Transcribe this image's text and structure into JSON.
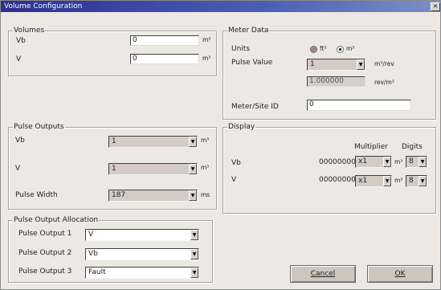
{
  "window": {
    "title": "Volume Configuration"
  },
  "volumes": {
    "legend": "Volumes",
    "vb_label": "Vb",
    "vb_value": "0",
    "vb_unit": "m³",
    "v_label": "V",
    "v_value": "0",
    "v_unit": "m³"
  },
  "pulse_outputs": {
    "legend": "Pulse Outputs",
    "vb_label": "Vb",
    "vb_value": "1",
    "vb_unit": "m³",
    "v_label": "V",
    "v_value": "1",
    "v_unit": "m³",
    "width_label": "Pulse Width",
    "width_value": "187",
    "width_unit": "ms"
  },
  "allocation": {
    "legend": "Pulse Output Allocation",
    "rows": [
      {
        "label": "Pulse Output 1",
        "value": "V"
      },
      {
        "label": "Pulse Output 2",
        "value": "Vb"
      },
      {
        "label": "Pulse Output 3",
        "value": "Fault"
      }
    ]
  },
  "meter_data": {
    "legend": "Meter Data",
    "units_label": "Units",
    "unit_ft3": "ft³",
    "unit_m3": "m³",
    "units_selected": "m³",
    "pulse_value_label": "Pulse Value",
    "pulse_value": "1",
    "pulse_value_unit": "m³/rev",
    "rev_value": "1.000000",
    "rev_unit": "rev/m³",
    "site_id_label": "Meter/Site ID",
    "site_id_value": "0"
  },
  "display": {
    "legend": "Display",
    "multiplier_header": "Multiplier",
    "digits_header": "Digits",
    "rows": [
      {
        "label": "Vb",
        "value": "00000000",
        "multiplier": "x1",
        "unit": "m³",
        "digits": "8"
      },
      {
        "label": "V",
        "value": "00000000",
        "multiplier": "x1",
        "unit": "m³",
        "digits": "8"
      }
    ]
  },
  "buttons": {
    "cancel": "Cancel",
    "ok": "OK"
  },
  "icons": {
    "close": "close-icon",
    "dropdown": "chevron-down-icon"
  }
}
